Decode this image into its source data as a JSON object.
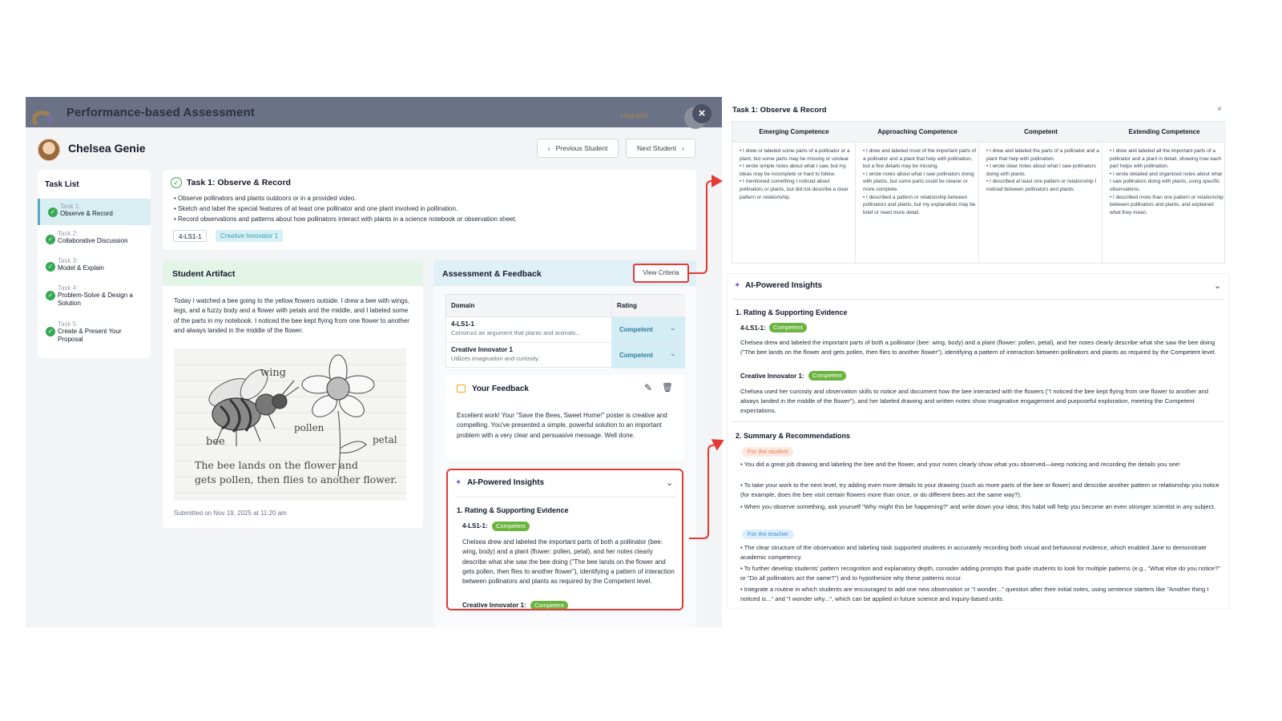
{
  "window": {
    "title": "Performance-based Assessment",
    "upgrade_label": "Upgrade",
    "close_glyph": "×"
  },
  "student": {
    "name": "Chelsea Genie",
    "prev_label": "Previous Student",
    "next_label": "Next Student"
  },
  "task_list": {
    "title": "Task List",
    "items": [
      {
        "num": "Task 1:",
        "name": "Observe & Record"
      },
      {
        "num": "Task 2:",
        "name": "Collaborative Discussion"
      },
      {
        "num": "Task 3:",
        "name": "Model & Explain"
      },
      {
        "num": "Task 4:",
        "name": "Problem-Solve & Design a Solution"
      },
      {
        "num": "Task 5:",
        "name": "Create & Present Your Proposal"
      }
    ]
  },
  "task": {
    "title": "Task 1: Observe & Record",
    "bullets": [
      "• Observe pollinators and plants outdoors or in a provided video.",
      "• Sketch and label the special features of at least one pollinator and one plant involved in pollination.",
      "• Record observations and patterns about how pollinators interact with plants in a science notebook or observation sheet."
    ],
    "tags": [
      "4-LS1-1",
      "Creative Innovator 1"
    ]
  },
  "artifact": {
    "title": "Student Artifact",
    "text": "Today I watched a bee going to the yellow flowers outside. I drew a bee with wings, legs, and a fuzzy body and a flower with petals and the middle, and I labeled some of the parts in my notebook. I noticed the bee kept flying from one flower to another and always landed in the middle of the flower.",
    "sketch_labels": {
      "wing": "wing",
      "bee": "bee",
      "pollen": "pollen",
      "petal": "petal",
      "caption1": "The bee lands on the flower and",
      "caption2": "gets pollen, then flies to another flower."
    },
    "submitted": "Submitted on Nov 19, 2025 at 11:20 am"
  },
  "assessment": {
    "title": "Assessment & Feedback",
    "view_criteria": "View Criteria",
    "table": {
      "headers": [
        "Domain",
        "Rating"
      ],
      "rows": [
        {
          "code": "4-LS1-1",
          "desc": "Construct an argument that plants and animals...",
          "rating": "Competent"
        },
        {
          "code": "Creative Innovator 1",
          "desc": "Utilizes imagination and curiosity.",
          "rating": "Competent"
        }
      ]
    },
    "feedback": {
      "title": "Your Feedback",
      "text": "Excellent work! Your \"Save the Bees, Sweet Home!\" poster is creative and compelling. You've presented a simple, powerful solution to an important problem with a very clear and persuasive message. Well done."
    },
    "ai": {
      "title": "AI-Powered Insights",
      "section1": "1. Rating & Supporting Evidence",
      "label1": "4-LS1-1:",
      "badge1": "Competent",
      "text1": "Chelsea drew and labeled the important parts of both a pollinator (bee: wing, body) and a plant (flower: pollen, petal), and her notes clearly describe what she saw the bee doing (\"The bee lands on the flower and gets pollen, then flies to another flower\"), identifying a pattern of interaction between pollinators and plants as required by the Competent level.",
      "label2": "Creative Innovator 1:",
      "badge2": "Competent"
    }
  },
  "criteria": {
    "title": "Task 1: Observe & Record",
    "close_glyph": "×",
    "columns": [
      {
        "head": "Emerging Competence",
        "items": [
          "• I drew or labeled some parts of a pollinator or a plant, but some parts may be missing or unclear.",
          "• I wrote simple notes about what I saw, but my ideas may be incomplete or hard to follow.",
          "• I mentioned something I noticed about pollinators or plants, but did not describe a clear pattern or relationship."
        ]
      },
      {
        "head": "Approaching Competence",
        "items": [
          "• I drew and labeled most of the important parts of a pollinator and a plant that help with pollination, but a few details may be missing.",
          "• I wrote notes about what I saw pollinators doing with plants, but some parts could be clearer or more complete.",
          "• I described a pattern or relationship between pollinators and plants, but my explanation may be brief or need more detail."
        ]
      },
      {
        "head": "Competent",
        "items": [
          "• I drew and labeled the parts of a pollinator and a plant that help with pollination.",
          "• I wrote clear notes about what I saw pollinators doing with plants.",
          "• I described at least one pattern or relationship I noticed between pollinators and plants."
        ]
      },
      {
        "head": "Extending Competence",
        "items": [
          "• I drew and labeled all the important parts of a pollinator and a plant in detail, showing how each part helps with pollination.",
          "• I wrote detailed and organized notes about what I saw pollinators doing with plants, using specific observations.",
          "• I described more than one pattern or relationship between pollinators and plants, and explained what they mean."
        ]
      }
    ]
  },
  "ai_full": {
    "title": "AI-Powered Insights",
    "section1": "1. Rating & Supporting Evidence",
    "label1": "4-LS1-1:",
    "badge1": "Competent",
    "text1": "Chelsea drew and labeled the important parts of both a pollinator (bee: wing, body) and a plant (flower: pollen, petal), and her notes clearly describe what she saw the bee doing (\"The bee lands on the flower and gets pollen, then flies to another flower\"), identifying a pattern of interaction between pollinators and plants as required by the Competent level.",
    "label2": "Creative Innovator 1:",
    "badge2": "Competent",
    "text2": "Chelsea used her curiosity and observation skills to notice and document how the bee interacted with the flowers (\"I noticed the bee kept flying from one flower to another and always landed in the middle of the flower\"), and her labeled drawing and written notes show imaginative engagement and purposeful exploration, meeting the Competent expectations.",
    "section2": "2. Summary & Recommendations",
    "for_student": "For the student",
    "student_items": [
      "• You did a great job drawing and labeling the bee and the flower, and your notes clearly show what you observed—keep noticing and recording the details you see!",
      "• To take your work to the next level, try adding even more details to your drawing (such as more parts of the bee or flower) and describe another pattern or relationship you notice (for example, does the bee visit certain flowers more than once, or do different bees act the same way?).",
      "• When you observe something, ask yourself \"Why might this be happening?\" and write down your idea; this habit will help you become an even stronger scientist in any subject."
    ],
    "for_teacher": "For the teacher",
    "teacher_items": [
      "• The clear structure of the observation and labeling task supported students in accurately recording both visual and behavioral evidence, which enabled Jane to demonstrate academic competency.",
      "• To further develop students' pattern recognition and explanatory depth, consider adding prompts that guide students to look for multiple patterns (e.g., \"What else do you notice?\" or \"Do all pollinators act the same?\") and to hypothesize why these patterns occur.",
      "• Integrate a routine in which students are encouraged to add one new observation or \"I wonder...\" question after their initial notes, using sentence starters like \"Another thing I noticed is...\" and \"I wonder why...\", which can be applied in future science and inquiry-based units."
    ]
  }
}
